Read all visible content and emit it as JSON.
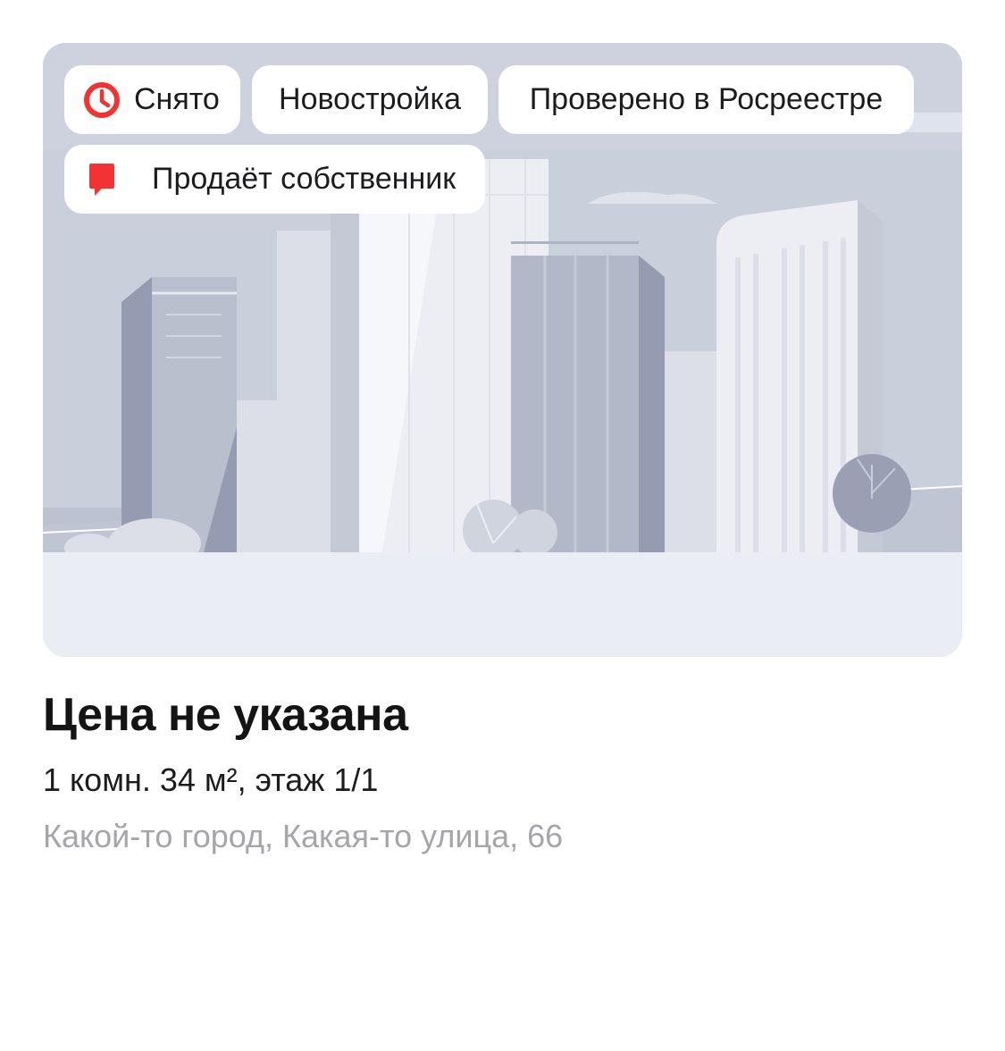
{
  "listing": {
    "badges": {
      "sold": {
        "label": "Снято",
        "icon": "clock-icon",
        "color": "#f33333"
      },
      "new_building": {
        "label": "Новостройка"
      },
      "registry": {
        "label": "Проверено в Росреестре"
      },
      "owner": {
        "label": "Продаёт собственник",
        "icon": "owner-flag-icon",
        "color": "#f33333"
      }
    },
    "image": {
      "placeholder": "city-skyline-illustration"
    },
    "price": "Цена не указана",
    "details": "1 комн. 34 м², этаж 1/1",
    "address": "Какой-то город, Какая-то улица, 66"
  },
  "colors": {
    "accent": "#f33333",
    "text_primary": "#141414",
    "text_secondary": "#a5a5aa",
    "image_background": "#c9cfdb"
  }
}
